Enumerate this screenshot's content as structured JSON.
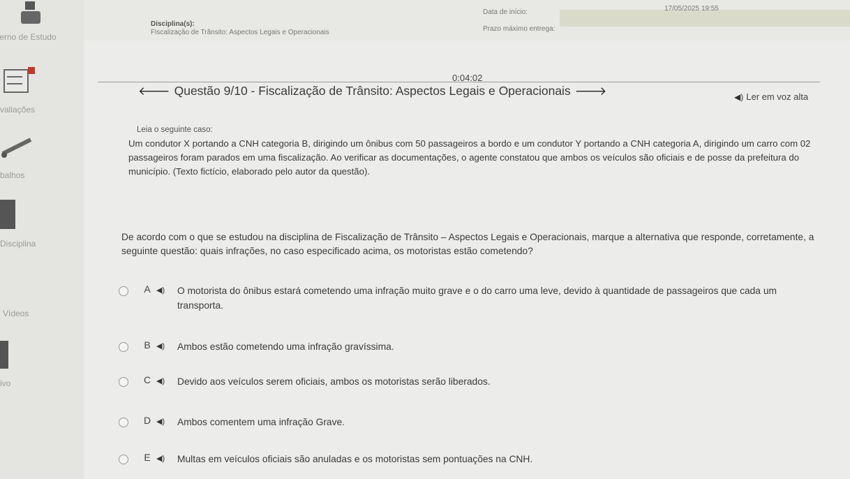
{
  "sidebar": {
    "items": [
      {
        "label": "terno de Estudo"
      },
      {
        "label": "valiações"
      },
      {
        "label": "balhos"
      },
      {
        "label": "Disciplina"
      },
      {
        "label": "Vídeos"
      },
      {
        "label": "ivo"
      }
    ]
  },
  "header": {
    "discipline_label": "Disciplina(s):",
    "discipline_value": "Fiscalização de Trânsito: Aspectos Legais e Operacionais",
    "start_label": "Data de início:",
    "start_value": "17/05/2025 19:55",
    "deadline_label": "Prazo máximo entrega:"
  },
  "timer": "0:04:02",
  "question": {
    "title": "Questão 9/10 - Fiscalização de Trânsito: Aspectos Legais e Operacionais",
    "read_aloud": "Ler em voz alta",
    "instruction": "Leia o seguinte caso:",
    "case_text": "Um condutor X portando a CNH categoria B, dirigindo um ônibus com 50 passageiros a bordo e um condutor Y portando a CNH categoria A, dirigindo um carro com 02 passageiros foram parados em uma fiscalização. Ao verificar as documentações, o agente constatou que ambos os veículos são oficiais e de posse da prefeitura do município. (Texto fictício, elaborado pelo autor da questão).",
    "prompt": "De acordo com o que se estudou na disciplina de Fiscalização de Trânsito – Aspectos Legais e Operacionais, marque a alternativa que responde, corretamente, a seguinte questão: quais infrações, no caso especificado acima, os motoristas estão cometendo?",
    "options": [
      {
        "letter": "A",
        "text": "O motorista do ônibus estará cometendo uma infração muito grave e o do carro uma leve, devido à quantidade de passageiros que cada um transporta."
      },
      {
        "letter": "B",
        "text": "Ambos estão cometendo uma infração gravíssima."
      },
      {
        "letter": "C",
        "text": "Devido aos veículos serem oficiais, ambos os motoristas serão liberados."
      },
      {
        "letter": "D",
        "text": "Ambos comentem uma infração Grave."
      },
      {
        "letter": "E",
        "text": "Multas em veículos oficiais são anuladas e os motoristas sem pontuações na CNH."
      }
    ]
  },
  "icons": {
    "prev": "arrow-left-icon",
    "next": "arrow-right-icon",
    "speaker": "speaker-icon"
  }
}
